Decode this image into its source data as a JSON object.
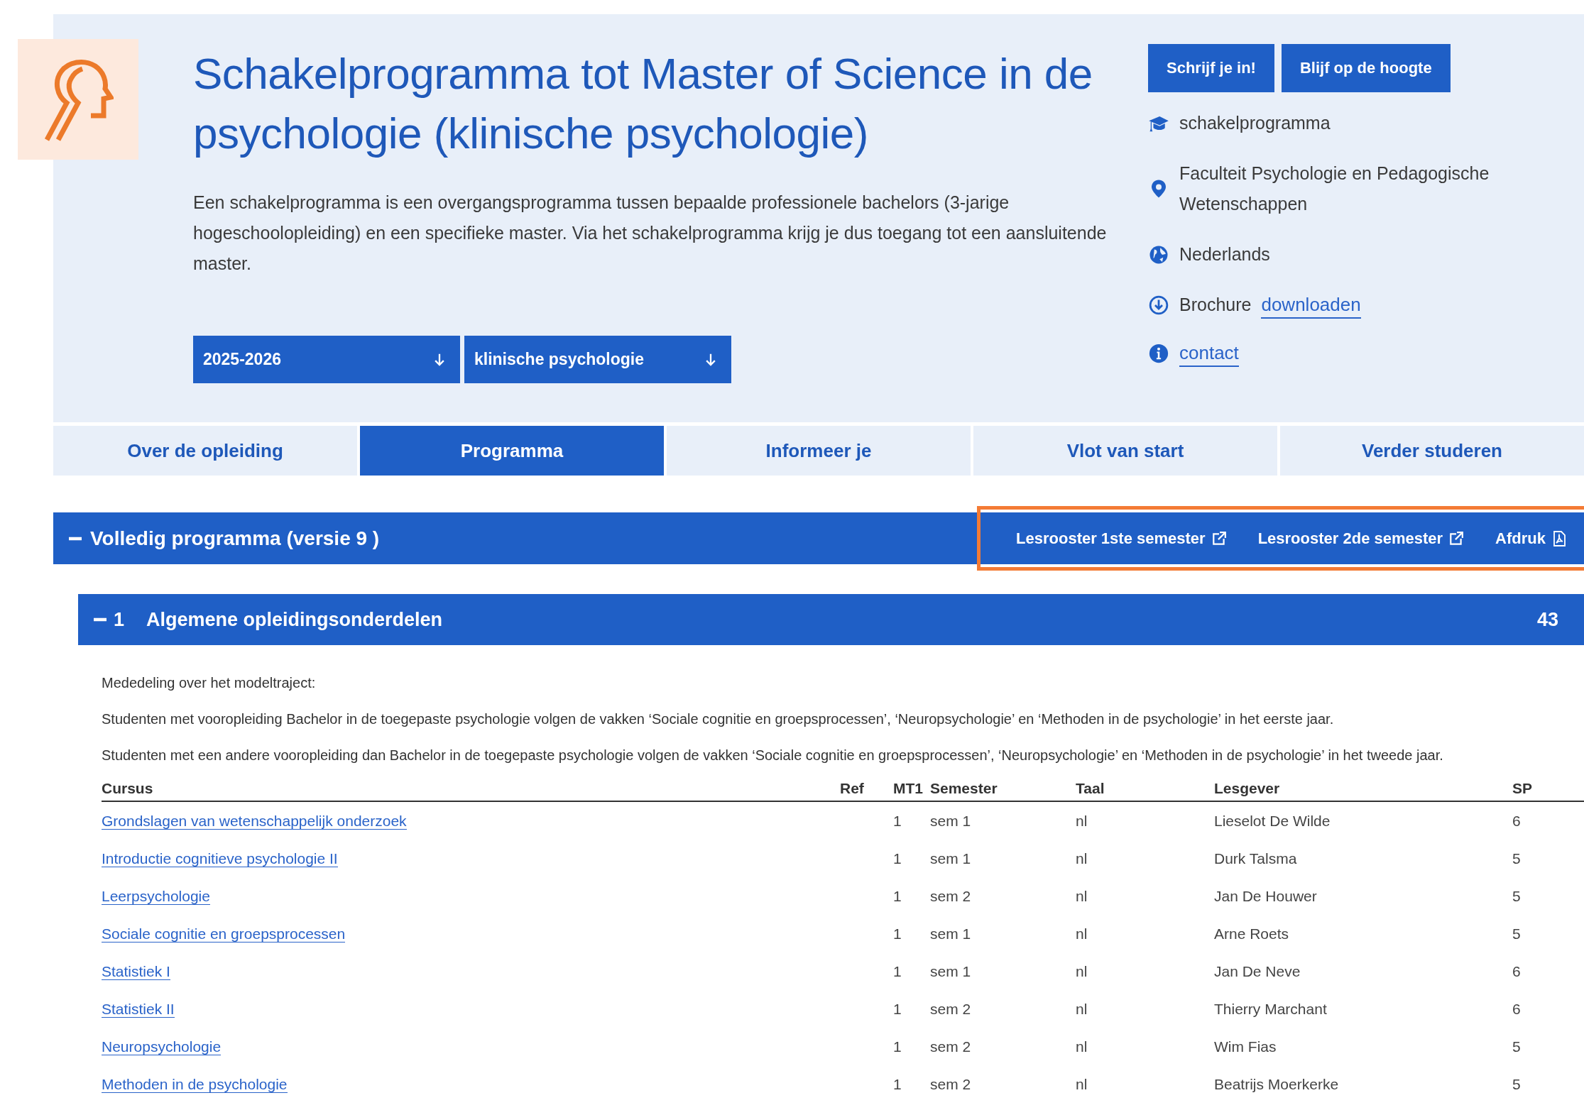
{
  "header": {
    "title": "Schakelprogramma tot Master of Science in de psychologie (klinische psychologie)",
    "description": "Een schakelprogramma is een overgangsprogramma tussen bepaalde professionele bachelors (3-jarige hogeschoolopleiding) en een specifieke master. Via het schakelprogramma krijg je dus toegang tot een aansluitende master.",
    "dropdowns": [
      {
        "value": "2025-2026"
      },
      {
        "value": "klinische psychologie"
      }
    ],
    "buttons": [
      "Schrijf je in!",
      "Blijf op de hoogte"
    ],
    "info": [
      {
        "kind": "cap",
        "text": "schakelprogramma"
      },
      {
        "kind": "pin",
        "text": "Faculteit Psychologie en Pedagogische Wetenschappen"
      },
      {
        "kind": "globe",
        "text": "Nederlands"
      },
      {
        "kind": "download",
        "text": "Brochure",
        "link": "downloaden"
      },
      {
        "kind": "info",
        "link": "contact"
      }
    ]
  },
  "tabs": [
    {
      "label": "Over de opleiding",
      "selected": false
    },
    {
      "label": "Programma",
      "selected": true
    },
    {
      "label": "Informeer je",
      "selected": false
    },
    {
      "label": "Vlot van start",
      "selected": false
    },
    {
      "label": "Verder studeren",
      "selected": false
    }
  ],
  "program": {
    "title": "Volledig programma (versie 9 )",
    "expanded": true,
    "highlighted": true,
    "links": [
      {
        "kind": "external",
        "label": "Lesrooster 1ste semester"
      },
      {
        "kind": "external",
        "label": "Lesrooster 2de semester"
      },
      {
        "kind": "pdf",
        "label": "Afdruk"
      }
    ]
  },
  "section": {
    "number": "1",
    "title": "Algemene opleidingsonderdelen",
    "credits": "43",
    "expanded": true,
    "notes": [
      "Mededeling over het modeltraject:",
      "Studenten met vooropleiding Bachelor in de toegepaste psychologie volgen de vakken ‘Sociale cognitie en groepsprocessen’, ‘Neuropsychologie’ en ‘Methoden in de psychologie’ in het eerste jaar.",
      "Studenten met een andere vooropleiding dan Bachelor in de toegepaste psychologie volgen de vakken ‘Sociale cognitie en groepsprocessen’, ‘Neuropsychologie’ en ‘Methoden in de psychologie’ in het tweede jaar."
    ],
    "columns": [
      "Cursus",
      "Ref",
      "MT1",
      "Semester",
      "Taal",
      "Lesgever",
      "SP"
    ],
    "rows": [
      [
        "Grondslagen van wetenschappelijk onderzoek",
        "",
        "1",
        "sem 1",
        "nl",
        "Lieselot De Wilde",
        "6"
      ],
      [
        "Introductie cognitieve psychologie II",
        "",
        "1",
        "sem 1",
        "nl",
        "Durk Talsma",
        "5"
      ],
      [
        "Leerpsychologie",
        "",
        "1",
        "sem 2",
        "nl",
        "Jan De Houwer",
        "5"
      ],
      [
        "Sociale cognitie en groepsprocessen",
        "",
        "1",
        "sem 1",
        "nl",
        "Arne Roets",
        "5"
      ],
      [
        "Statistiek I",
        "",
        "1",
        "sem 1",
        "nl",
        "Jan De Neve",
        "6"
      ],
      [
        "Statistiek II",
        "",
        "1",
        "sem 2",
        "nl",
        "Thierry Marchant",
        "6"
      ],
      [
        "Neuropsychologie",
        "",
        "1",
        "sem 2",
        "nl",
        "Wim Fias",
        "5"
      ],
      [
        "Methoden in de psychologie",
        "",
        "1",
        "sem 2",
        "nl",
        "Beatrijs Moerkerke",
        "5"
      ]
    ]
  }
}
